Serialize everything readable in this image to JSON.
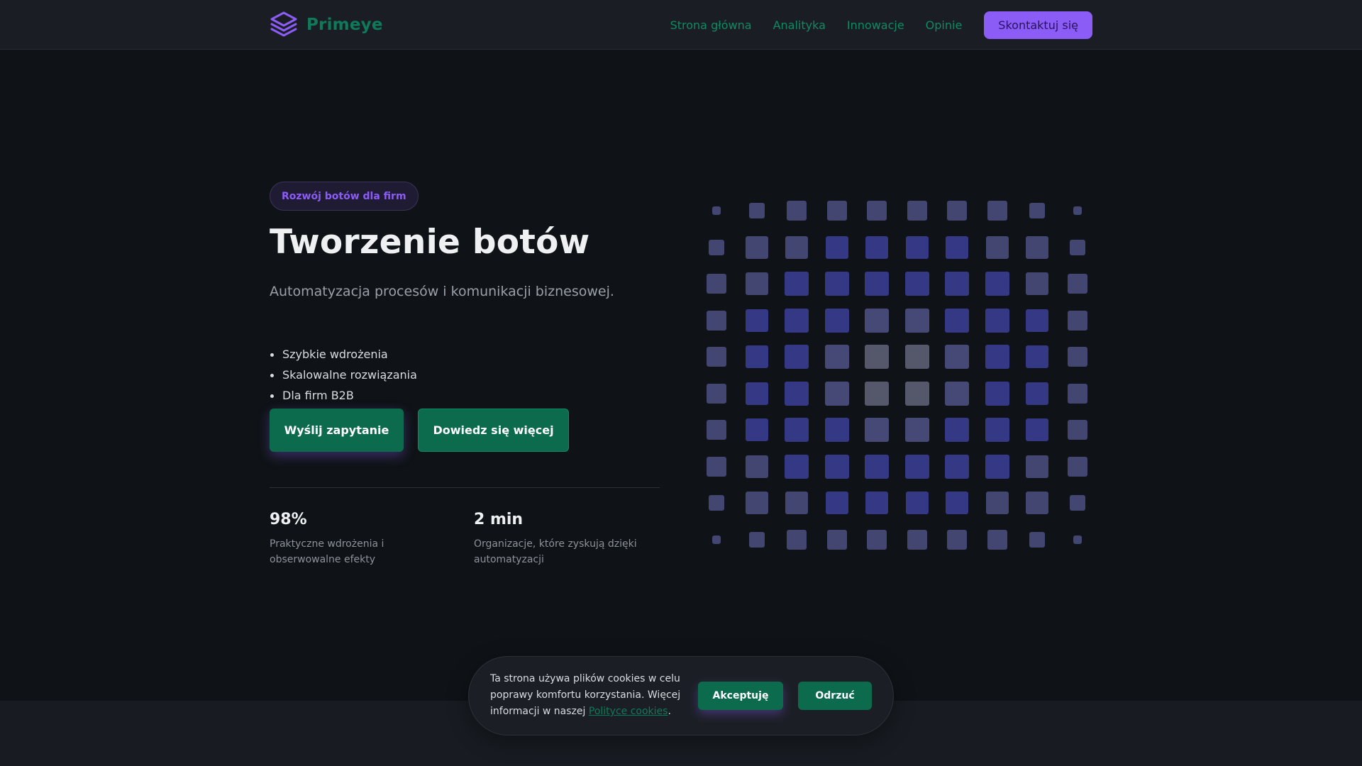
{
  "header": {
    "brand_name": "Primeye",
    "logo_icon": "stacked-layers-icon",
    "nav": [
      {
        "label": "Strona główna"
      },
      {
        "label": "Analityka"
      },
      {
        "label": "Innowacje"
      },
      {
        "label": "Opinie"
      }
    ],
    "cta_label": "Skontaktuj się"
  },
  "hero": {
    "badge": "Rozwój botów dla firm",
    "title": "Tworzenie botów",
    "subtitle": "Automatyzacja procesów i komunikacji biznesowej.",
    "features": [
      "Szybkie wdrożenia",
      "Skalowalne rozwiązania",
      "Dla firm B2B"
    ],
    "primary_button": "Wyślij zapytanie",
    "secondary_button": "Dowiedz się więcej",
    "stats": [
      {
        "value": "98%",
        "label": "Praktyczne wdrożenia i obserwowalne efekty"
      },
      {
        "value": "2 min",
        "label": "Organizacje, które zyskują dzięki automatyzacji"
      }
    ]
  },
  "cookie_banner": {
    "text": "Ta strona używa plików cookies w celu poprawy komfortu korzystania. Więcej informacji w naszej",
    "link_label": "Polityce cookies",
    "suffix": ".",
    "accept_label": "Akceptuję",
    "reject_label": "Odrzuć"
  },
  "colors": {
    "accent_purple": "#8b5cf6",
    "accent_green": "#0b6b4c",
    "background": "#0f1317"
  }
}
